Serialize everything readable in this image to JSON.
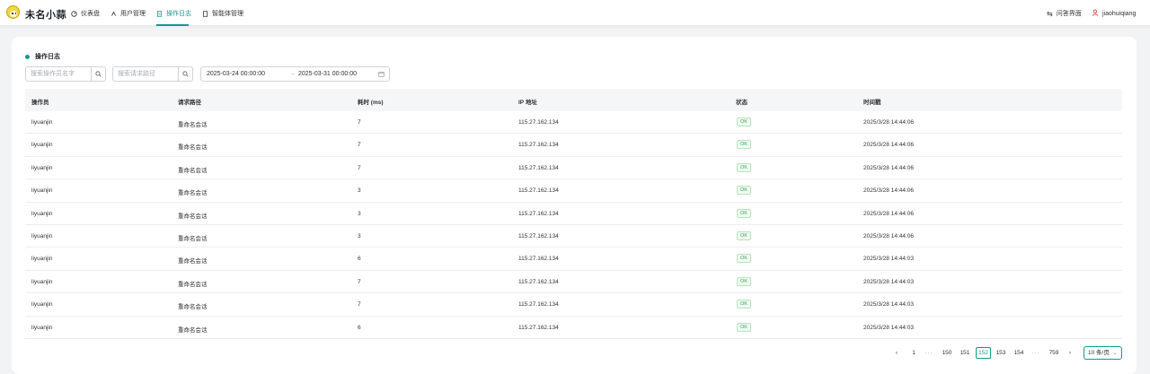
{
  "app": {
    "brand": "未名小蒜"
  },
  "nav": {
    "items": [
      {
        "label": "仪表盘",
        "icon": "dashboard-icon"
      },
      {
        "label": "用户管理",
        "icon": "users-icon"
      },
      {
        "label": "操作日志",
        "icon": "log-icon",
        "active": true
      },
      {
        "label": "智能体管理",
        "icon": "agent-icon"
      }
    ],
    "right": {
      "qa": "问答界面",
      "user": "jiaohuiqiang"
    }
  },
  "section": {
    "title": "操作日志"
  },
  "filters": {
    "operator_placeholder": "搜索操作员名字",
    "path_placeholder": "搜索请求路径",
    "date_start": "2025-03-24 00:00:00",
    "date_sep": "→",
    "date_end": "2025-03-31 00:00:00"
  },
  "table": {
    "columns": [
      "操作员",
      "请求路径",
      "耗时 (ms)",
      "IP 地址",
      "状态",
      "时间戳"
    ],
    "rows": [
      [
        "liyuanjin",
        "重命名会话",
        "7",
        "115.27.162.134",
        "OK",
        "2025/3/28 14:44:06"
      ],
      [
        "liyuanjin",
        "重命名会话",
        "7",
        "115.27.162.134",
        "OK",
        "2025/3/28 14:44:06"
      ],
      [
        "liyuanjin",
        "重命名会话",
        "7",
        "115.27.162.134",
        "OK",
        "2025/3/28 14:44:06"
      ],
      [
        "liyuanjin",
        "重命名会话",
        "3",
        "115.27.162.134",
        "OK",
        "2025/3/28 14:44:06"
      ],
      [
        "liyuanjin",
        "重命名会话",
        "3",
        "115.27.162.134",
        "OK",
        "2025/3/28 14:44:06"
      ],
      [
        "liyuanjin",
        "重命名会话",
        "3",
        "115.27.162.134",
        "OK",
        "2025/3/28 14:44:06"
      ],
      [
        "liyuanjin",
        "重命名会话",
        "6",
        "115.27.162.134",
        "OK",
        "2025/3/28 14:44:03"
      ],
      [
        "liyuanjin",
        "重命名会话",
        "7",
        "115.27.162.134",
        "OK",
        "2025/3/28 14:44:03"
      ],
      [
        "liyuanjin",
        "重命名会话",
        "7",
        "115.27.162.134",
        "OK",
        "2025/3/28 14:44:03"
      ],
      [
        "liyuanjin",
        "重命名会话",
        "6",
        "115.27.162.134",
        "OK",
        "2025/3/28 14:44:03"
      ]
    ]
  },
  "pagination": {
    "prev": "‹",
    "pages": [
      "1",
      "···",
      "150",
      "151",
      "152",
      "153",
      "154",
      "···",
      "759"
    ],
    "current": "152",
    "next": "›",
    "page_size": "10 条/页"
  },
  "colors": {
    "accent": "#0f9b8e",
    "ok_badge": "#39a650"
  }
}
